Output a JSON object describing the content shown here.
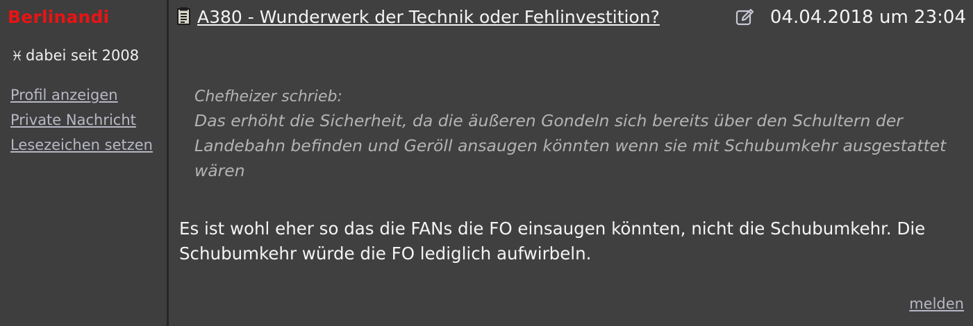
{
  "author": {
    "name": "Berlinandi",
    "member_since_badge": "♓",
    "member_since": "dabei seit 2008"
  },
  "author_links": [
    {
      "label": "Profil anzeigen"
    },
    {
      "label": "Private Nachricht"
    },
    {
      "label": "Lesezeichen setzen"
    }
  ],
  "topic": {
    "icon": "document-icon",
    "title": "A380 - Wunderwerk der Technik oder Fehlinvestition?"
  },
  "edit_icon": "edit-icon",
  "timestamp": "04.04.2018 um 23:04",
  "quote": {
    "author_line": "Chefheizer schrieb:",
    "text": "Das erhöht die Sicherheit, da die äußeren Gondeln sich bereits über den Schultern der Landebahn befinden und Geröll ansaugen könnten wenn sie mit Schubumkehr ausgestattet wären"
  },
  "body_text": "Es ist wohl eher so das die FANs die FO einsaugen könnten, nicht die Schubumkehr. Die Schubumkehr würde die FO lediglich aufwirbeln.",
  "report_label": "melden",
  "colors": {
    "background": "#404040",
    "username": "#e81414",
    "link": "#b8b8c6",
    "quote": "#b4b4b4",
    "text": "#f4f4f4"
  }
}
